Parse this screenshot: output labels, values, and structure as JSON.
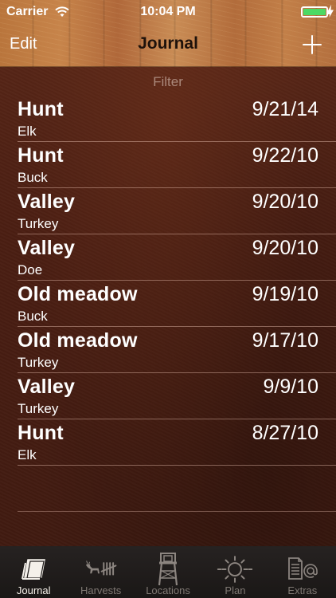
{
  "status_bar": {
    "carrier": "Carrier",
    "time": "10:04 PM",
    "battery_color": "#4cd964"
  },
  "nav": {
    "edit_label": "Edit",
    "title": "Journal",
    "add_icon": "plus-icon"
  },
  "filter_label": "Filter",
  "entries": [
    {
      "title": "Hunt",
      "subtitle": "Elk",
      "date": "9/21/14"
    },
    {
      "title": "Hunt",
      "subtitle": "Buck",
      "date": "9/22/10"
    },
    {
      "title": "Valley",
      "subtitle": "Turkey",
      "date": "9/20/10"
    },
    {
      "title": "Valley",
      "subtitle": "Doe",
      "date": "9/20/10"
    },
    {
      "title": "Old meadow",
      "subtitle": "Buck",
      "date": "9/19/10"
    },
    {
      "title": "Old meadow",
      "subtitle": "Turkey",
      "date": "9/17/10"
    },
    {
      "title": "Valley",
      "subtitle": "Turkey",
      "date": "9/9/10"
    },
    {
      "title": "Hunt",
      "subtitle": "Elk",
      "date": "8/27/10"
    }
  ],
  "tabs": [
    {
      "label": "Journal",
      "icon": "journal-icon",
      "active": true
    },
    {
      "label": "Harvests",
      "icon": "harvest-tally-icon",
      "active": false
    },
    {
      "label": "Locations",
      "icon": "tree-stand-icon",
      "active": false
    },
    {
      "label": "Plan",
      "icon": "sun-icon",
      "active": false
    },
    {
      "label": "Extras",
      "icon": "extras-icon",
      "active": false
    }
  ]
}
